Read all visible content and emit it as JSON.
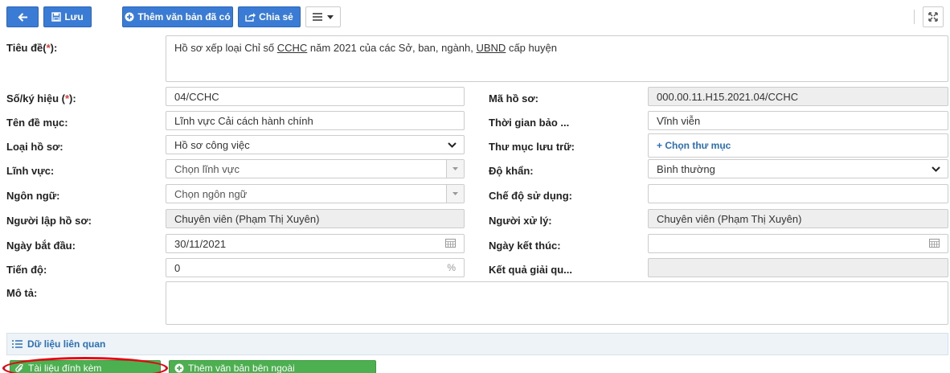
{
  "toolbar": {
    "save_label": "Lưu",
    "add_existing_label": "Thêm văn bản đã có",
    "share_label": "Chia sẻ"
  },
  "form": {
    "title": {
      "label": "Tiêu đề(",
      "req": "*",
      "suffix": "):",
      "value_pre": "Hồ sơ xếp loại Chỉ số ",
      "value_u1": "CCHC",
      "value_mid": " năm 2021 của các Sở, ban, ngành, ",
      "value_u2": "UBND",
      "value_post": " cấp huyện"
    },
    "symbol": {
      "label": "Số/ký hiệu (",
      "req": "*",
      "suffix": "):",
      "value": "04/CCHC"
    },
    "file_code": {
      "label": "Mã hồ sơ:",
      "value": "000.00.11.H15.2021.04/CCHC"
    },
    "heading_name": {
      "label": "Tên đề mục:",
      "value": "Lĩnh vực Cải cách hành chính"
    },
    "retention": {
      "label": "Thời gian bảo ...",
      "value": "Vĩnh viễn"
    },
    "file_type": {
      "label": "Loại hồ sơ:",
      "value": "Hồ sơ công việc"
    },
    "storage_folder": {
      "label": "Thư mục lưu trữ:",
      "link": "+ Chọn thư mục"
    },
    "field": {
      "label": "Lĩnh vực:",
      "placeholder": "Chọn lĩnh vực"
    },
    "urgency": {
      "label": "Độ khẩn:",
      "value": "Bình thường"
    },
    "language": {
      "label": "Ngôn ngữ:",
      "placeholder": "Chọn ngôn ngữ"
    },
    "usage_mode": {
      "label": "Chế độ sử dụng:",
      "value": ""
    },
    "creator": {
      "label": "Người lập hồ sơ:",
      "value": "Chuyên viên (Phạm Thị Xuyên)"
    },
    "handler": {
      "label": "Người xử lý:",
      "value": "Chuyên viên (Phạm Thị Xuyên)"
    },
    "start_date": {
      "label": "Ngày bắt đầu:",
      "value": "30/11/2021"
    },
    "end_date": {
      "label": "Ngày kết thúc:",
      "value": ""
    },
    "progress": {
      "label": "Tiến độ:",
      "value": "0",
      "unit": "%"
    },
    "result": {
      "label": "Kết quả giải qu...",
      "value": ""
    },
    "description": {
      "label": "Mô tả:",
      "value": ""
    }
  },
  "related": {
    "label": "Dữ liệu liên quan"
  },
  "bottom": {
    "attachments_label": "Tài liệu đính kèm",
    "add_external_label": "Thêm văn bản bên ngoài"
  },
  "colors": {
    "primary": "#3a7bd5",
    "success": "#4caf50",
    "highlight": "#e30613",
    "link": "#2a6fb8"
  }
}
